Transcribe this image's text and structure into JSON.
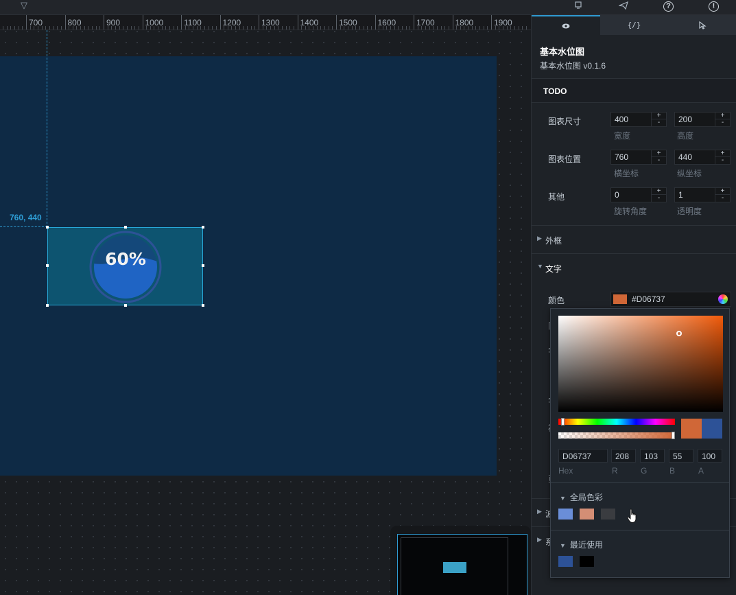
{
  "topbar": {
    "icons": [
      "chevron-down-icon",
      "monitor-icon",
      "send-icon",
      "help-icon",
      "info-icon"
    ],
    "help_glyph": "?",
    "info_glyph": "!"
  },
  "ruler": {
    "labels": [
      "700",
      "800",
      "900",
      "1000",
      "1100",
      "1200",
      "1300",
      "1400",
      "1500",
      "1600",
      "1700",
      "1800",
      "1900"
    ]
  },
  "canvas": {
    "coord_label": "760, 440",
    "widget_text": "60%",
    "widget_percent": 60
  },
  "panel": {
    "tabs": [
      {
        "name": "style",
        "icon": "eye-icon",
        "label": ""
      },
      {
        "name": "data",
        "icon": "code-icon",
        "label": "{/}"
      },
      {
        "name": "interaction",
        "icon": "cursor-icon",
        "label": ""
      }
    ],
    "title": "基本水位图",
    "subtitle": "基本水位图 v0.1.6",
    "todo": "TODO",
    "size": {
      "label": "图表尺寸",
      "width": "400",
      "width_label": "宽度",
      "height": "200",
      "height_label": "高度"
    },
    "position": {
      "label": "图表位置",
      "x": "760",
      "x_label": "横坐标",
      "y": "440",
      "y_label": "纵坐标"
    },
    "other": {
      "label": "其他",
      "rotation": "0",
      "rotation_label": "旋转角度",
      "opacity": "1",
      "opacity_label": "透明度"
    },
    "stepper_plus": "+",
    "stepper_minus": "-",
    "sections": {
      "border": "外框",
      "text": "文字"
    },
    "text_color": {
      "label": "颜色",
      "hex": "#D06737",
      "color": "#D06737"
    },
    "hidden_partial": [
      "同",
      "字",
      "字",
      "衫",
      "页",
      "波",
      "系"
    ]
  },
  "picker": {
    "hex": "D06737",
    "r": "208",
    "g": "103",
    "b": "55",
    "a": "100",
    "labels": {
      "hex": "Hex",
      "r": "R",
      "g": "G",
      "b": "B",
      "a": "A"
    },
    "preview_new": "#D06737",
    "preview_old": "#2D5297",
    "global_colors_title": "全局色彩",
    "global_colors": [
      "#6A8ED8",
      "#D48E75",
      "#3A3C40"
    ],
    "recent_title": "最近使用",
    "recent_colors": [
      "#2D5297",
      "#000000"
    ]
  }
}
